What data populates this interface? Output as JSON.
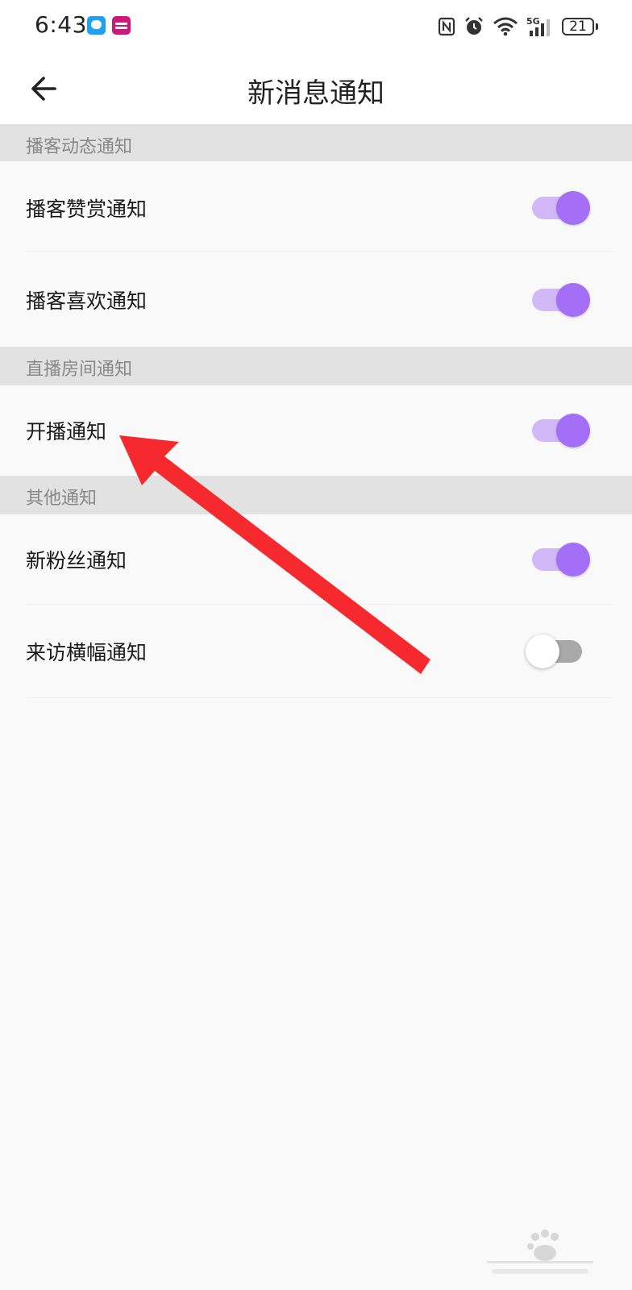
{
  "status_bar": {
    "time": "6:43",
    "battery": "21",
    "network": "5G"
  },
  "header": {
    "title": "新消息通知"
  },
  "sections": [
    {
      "title": "播客动态通知",
      "items": [
        {
          "label": "播客赞赏通知",
          "enabled": true
        },
        {
          "label": "播客喜欢通知",
          "enabled": true
        }
      ]
    },
    {
      "title": "直播房间通知",
      "items": [
        {
          "label": "开播通知",
          "enabled": true
        }
      ]
    },
    {
      "title": "其他通知",
      "items": [
        {
          "label": "新粉丝通知",
          "enabled": true
        },
        {
          "label": "来访横幅通知",
          "enabled": false
        }
      ]
    }
  ],
  "colors": {
    "toggle_on_knob": "#a56ef6",
    "toggle_on_track": "#d1b8f7",
    "toggle_off_track": "#a9a9a9",
    "annotation_arrow": "#f5292e"
  },
  "icons": {
    "back": "arrow-left-icon",
    "annotation": "red-arrow-pointer"
  }
}
